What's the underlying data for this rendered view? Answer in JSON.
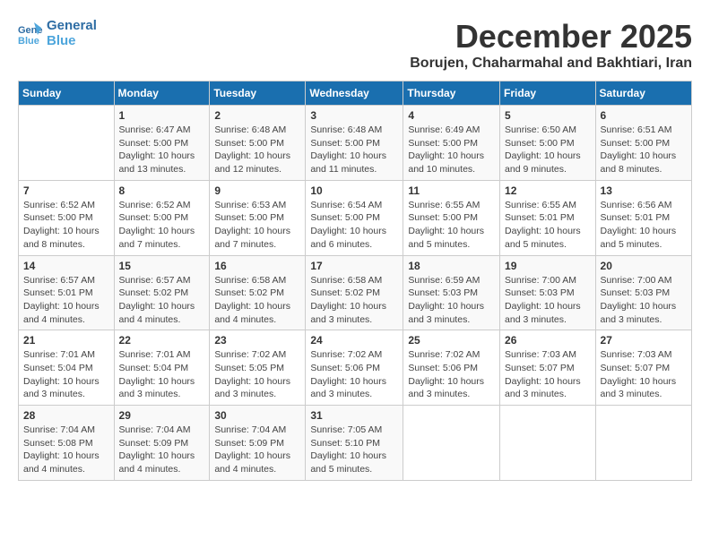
{
  "app": {
    "logo_line1": "General",
    "logo_line2": "Blue"
  },
  "header": {
    "title": "December 2025",
    "subtitle": "Borujen, Chaharmahal and Bakhtiari, Iran"
  },
  "calendar": {
    "weekdays": [
      "Sunday",
      "Monday",
      "Tuesday",
      "Wednesday",
      "Thursday",
      "Friday",
      "Saturday"
    ],
    "weeks": [
      [
        {
          "day": "",
          "info": ""
        },
        {
          "day": "1",
          "info": "Sunrise: 6:47 AM\nSunset: 5:00 PM\nDaylight: 10 hours\nand 13 minutes."
        },
        {
          "day": "2",
          "info": "Sunrise: 6:48 AM\nSunset: 5:00 PM\nDaylight: 10 hours\nand 12 minutes."
        },
        {
          "day": "3",
          "info": "Sunrise: 6:48 AM\nSunset: 5:00 PM\nDaylight: 10 hours\nand 11 minutes."
        },
        {
          "day": "4",
          "info": "Sunrise: 6:49 AM\nSunset: 5:00 PM\nDaylight: 10 hours\nand 10 minutes."
        },
        {
          "day": "5",
          "info": "Sunrise: 6:50 AM\nSunset: 5:00 PM\nDaylight: 10 hours\nand 9 minutes."
        },
        {
          "day": "6",
          "info": "Sunrise: 6:51 AM\nSunset: 5:00 PM\nDaylight: 10 hours\nand 8 minutes."
        }
      ],
      [
        {
          "day": "7",
          "info": "Sunrise: 6:52 AM\nSunset: 5:00 PM\nDaylight: 10 hours\nand 8 minutes."
        },
        {
          "day": "8",
          "info": "Sunrise: 6:52 AM\nSunset: 5:00 PM\nDaylight: 10 hours\nand 7 minutes."
        },
        {
          "day": "9",
          "info": "Sunrise: 6:53 AM\nSunset: 5:00 PM\nDaylight: 10 hours\nand 7 minutes."
        },
        {
          "day": "10",
          "info": "Sunrise: 6:54 AM\nSunset: 5:00 PM\nDaylight: 10 hours\nand 6 minutes."
        },
        {
          "day": "11",
          "info": "Sunrise: 6:55 AM\nSunset: 5:00 PM\nDaylight: 10 hours\nand 5 minutes."
        },
        {
          "day": "12",
          "info": "Sunrise: 6:55 AM\nSunset: 5:01 PM\nDaylight: 10 hours\nand 5 minutes."
        },
        {
          "day": "13",
          "info": "Sunrise: 6:56 AM\nSunset: 5:01 PM\nDaylight: 10 hours\nand 5 minutes."
        }
      ],
      [
        {
          "day": "14",
          "info": "Sunrise: 6:57 AM\nSunset: 5:01 PM\nDaylight: 10 hours\nand 4 minutes."
        },
        {
          "day": "15",
          "info": "Sunrise: 6:57 AM\nSunset: 5:02 PM\nDaylight: 10 hours\nand 4 minutes."
        },
        {
          "day": "16",
          "info": "Sunrise: 6:58 AM\nSunset: 5:02 PM\nDaylight: 10 hours\nand 4 minutes."
        },
        {
          "day": "17",
          "info": "Sunrise: 6:58 AM\nSunset: 5:02 PM\nDaylight: 10 hours\nand 3 minutes."
        },
        {
          "day": "18",
          "info": "Sunrise: 6:59 AM\nSunset: 5:03 PM\nDaylight: 10 hours\nand 3 minutes."
        },
        {
          "day": "19",
          "info": "Sunrise: 7:00 AM\nSunset: 5:03 PM\nDaylight: 10 hours\nand 3 minutes."
        },
        {
          "day": "20",
          "info": "Sunrise: 7:00 AM\nSunset: 5:03 PM\nDaylight: 10 hours\nand 3 minutes."
        }
      ],
      [
        {
          "day": "21",
          "info": "Sunrise: 7:01 AM\nSunset: 5:04 PM\nDaylight: 10 hours\nand 3 minutes."
        },
        {
          "day": "22",
          "info": "Sunrise: 7:01 AM\nSunset: 5:04 PM\nDaylight: 10 hours\nand 3 minutes."
        },
        {
          "day": "23",
          "info": "Sunrise: 7:02 AM\nSunset: 5:05 PM\nDaylight: 10 hours\nand 3 minutes."
        },
        {
          "day": "24",
          "info": "Sunrise: 7:02 AM\nSunset: 5:06 PM\nDaylight: 10 hours\nand 3 minutes."
        },
        {
          "day": "25",
          "info": "Sunrise: 7:02 AM\nSunset: 5:06 PM\nDaylight: 10 hours\nand 3 minutes."
        },
        {
          "day": "26",
          "info": "Sunrise: 7:03 AM\nSunset: 5:07 PM\nDaylight: 10 hours\nand 3 minutes."
        },
        {
          "day": "27",
          "info": "Sunrise: 7:03 AM\nSunset: 5:07 PM\nDaylight: 10 hours\nand 3 minutes."
        }
      ],
      [
        {
          "day": "28",
          "info": "Sunrise: 7:04 AM\nSunset: 5:08 PM\nDaylight: 10 hours\nand 4 minutes."
        },
        {
          "day": "29",
          "info": "Sunrise: 7:04 AM\nSunset: 5:09 PM\nDaylight: 10 hours\nand 4 minutes."
        },
        {
          "day": "30",
          "info": "Sunrise: 7:04 AM\nSunset: 5:09 PM\nDaylight: 10 hours\nand 4 minutes."
        },
        {
          "day": "31",
          "info": "Sunrise: 7:05 AM\nSunset: 5:10 PM\nDaylight: 10 hours\nand 5 minutes."
        },
        {
          "day": "",
          "info": ""
        },
        {
          "day": "",
          "info": ""
        },
        {
          "day": "",
          "info": ""
        }
      ]
    ]
  }
}
